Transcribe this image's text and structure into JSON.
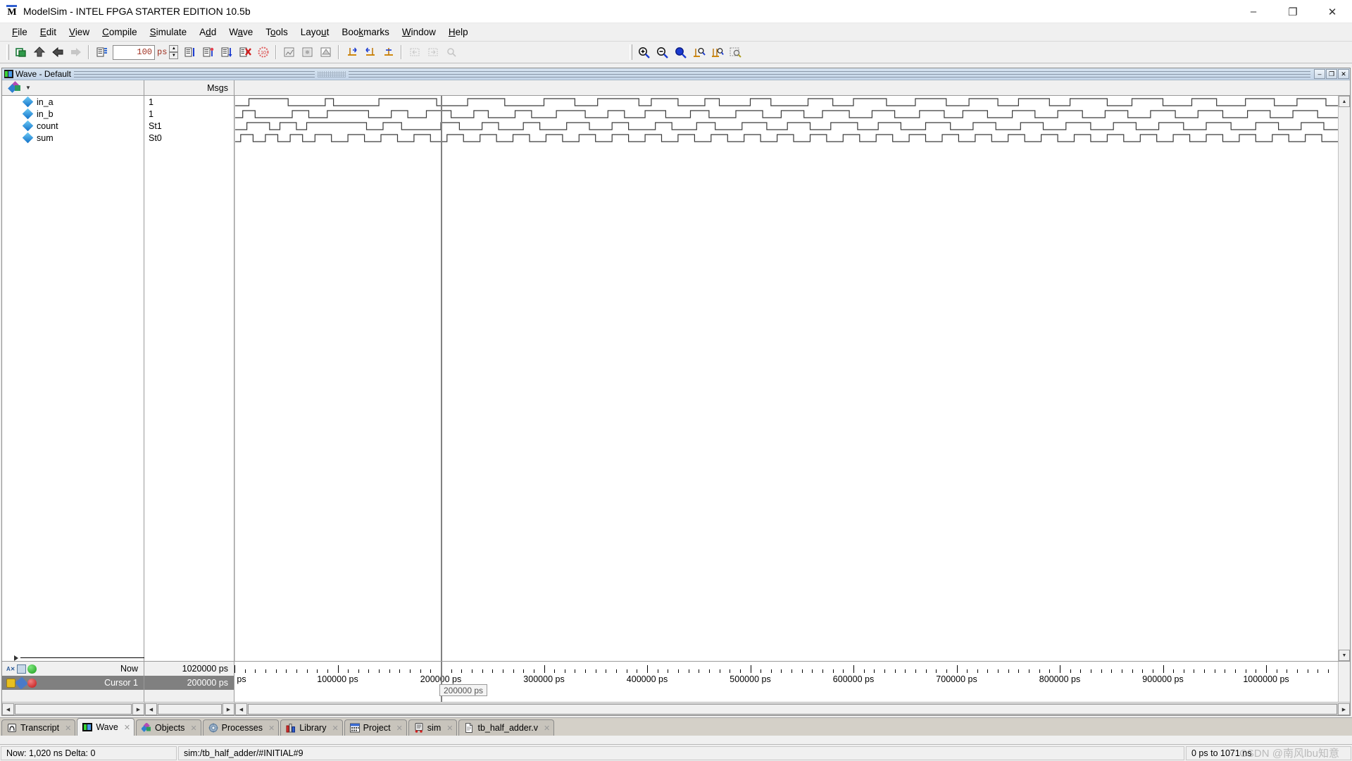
{
  "window": {
    "title": "ModelSim - INTEL FPGA STARTER EDITION 10.5b",
    "app_icon": "modelsim-icon",
    "minimize": "–",
    "maximize": "❐",
    "close": "✕"
  },
  "menubar": {
    "items": [
      {
        "label": "File",
        "mnemonic": "F"
      },
      {
        "label": "Edit",
        "mnemonic": "E"
      },
      {
        "label": "View",
        "mnemonic": "V"
      },
      {
        "label": "Compile",
        "mnemonic": "C"
      },
      {
        "label": "Simulate",
        "mnemonic": "S"
      },
      {
        "label": "Add",
        "mnemonic": "d"
      },
      {
        "label": "Wave",
        "mnemonic": "a"
      },
      {
        "label": "Tools",
        "mnemonic": "o"
      },
      {
        "label": "Layout",
        "mnemonic": "u"
      },
      {
        "label": "Bookmarks",
        "mnemonic": "k"
      },
      {
        "label": "Window",
        "mnemonic": "W"
      },
      {
        "label": "Help",
        "mnemonic": "H"
      }
    ]
  },
  "toolbar": {
    "run_time_value": "100",
    "run_time_unit": "ps",
    "buttons": [
      "copy-icon",
      "up-arrow-icon",
      "back-arrow-icon",
      "forward-faded-icon",
      "restart-icon",
      "run-icon",
      "continue-run-icon",
      "run-all-icon",
      "break-icon",
      "stop-icon",
      "step-icon",
      "step-over-icon",
      "step-out-icon",
      "insert-cursor-icon",
      "delete-cursor-icon",
      "find-previous-icon",
      "find-next-icon",
      "zoom-in-icon",
      "zoom-out-icon",
      "zoom-full-icon",
      "zoom-cursor-icon",
      "zoom-range-icon",
      "zoom-last-icon"
    ]
  },
  "wave_window": {
    "title": "Wave - Default",
    "icon": "wave-window-icon",
    "minimize": "–",
    "restore": "❐",
    "close": "✕",
    "msgs_header": "Msgs",
    "signals": [
      {
        "name": "in_a",
        "value": "1",
        "icon": "signal-diamond-icon"
      },
      {
        "name": "in_b",
        "value": "1",
        "icon": "signal-diamond-icon"
      },
      {
        "name": "count",
        "value": "St1",
        "icon": "signal-diamond-icon"
      },
      {
        "name": "sum",
        "value": "St0",
        "icon": "signal-diamond-icon"
      }
    ],
    "cursor_flag_label": "200000 ps",
    "now_label": "Now",
    "now_value": "1020000 ps",
    "cursor_label": "Cursor 1",
    "cursor_value": "200000 ps",
    "timeline": {
      "unit": "ps",
      "start_label": "ps",
      "labels": [
        "100000 ps",
        "200000 ps",
        "300000 ps",
        "400000 ps",
        "500000 ps",
        "600000 ps",
        "700000 ps",
        "800000 ps",
        "900000 ps",
        "1000000 ps"
      ],
      "min": 0,
      "max": 1071000,
      "major_step": 100000,
      "minor_step": 10000
    }
  },
  "waveforms": {
    "cursor_time": 200000,
    "traces": [
      {
        "signal": "in_a",
        "initial": 0,
        "edges": [
          14000,
          52000,
          88000,
          96000,
          140000,
          196000,
          226000,
          262000,
          300000,
          330000,
          352000,
          392000,
          404000,
          430000,
          456000,
          470000,
          500000,
          520000,
          556000,
          580000,
          600000,
          632000,
          660000,
          690000,
          712000,
          740000,
          760000,
          790000,
          810000,
          846000,
          870000,
          900000,
          928000,
          952000,
          980000,
          1008000,
          1030000,
          1058000
        ]
      },
      {
        "signal": "in_b",
        "initial": 0,
        "edges": [
          8000,
          20000,
          56000,
          72000,
          90000,
          130000,
          152000,
          168000,
          186000,
          210000,
          232000,
          246000,
          272000,
          288000,
          312000,
          340000,
          362000,
          378000,
          398000,
          418000,
          442000,
          460000,
          486000,
          512000,
          530000,
          552000,
          570000,
          596000,
          618000,
          640000,
          664000,
          688000,
          706000,
          730000,
          754000,
          776000,
          798000,
          822000,
          844000,
          866000,
          888000,
          912000,
          934000,
          958000,
          982000,
          1004000,
          1026000,
          1050000
        ]
      },
      {
        "signal": "count",
        "initial": 0,
        "edges": [
          12000,
          34000,
          44000,
          60000,
          70000,
          128000,
          144000,
          162000,
          200000,
          218000,
          240000,
          256000,
          280000,
          296000,
          322000,
          344000,
          366000,
          382000,
          408000,
          424000,
          448000,
          466000,
          492000,
          516000,
          536000,
          558000,
          578000,
          604000,
          624000,
          646000,
          670000,
          694000,
          716000,
          738000,
          762000,
          784000,
          806000,
          830000,
          852000,
          874000,
          896000,
          920000,
          942000,
          966000,
          990000,
          1012000,
          1034000,
          1056000
        ]
      },
      {
        "signal": "sum",
        "initial": 0,
        "edges": [
          6000,
          18000,
          30000,
          42000,
          54000,
          66000,
          78000,
          94000,
          110000,
          126000,
          142000,
          158000,
          174000,
          190000,
          206000,
          222000,
          238000,
          254000,
          270000,
          286000,
          302000,
          318000,
          334000,
          350000,
          366000,
          382000,
          398000,
          414000,
          430000,
          446000,
          462000,
          478000,
          494000,
          510000,
          526000,
          542000,
          558000,
          574000,
          590000,
          606000,
          622000,
          638000,
          654000,
          670000,
          686000,
          702000,
          718000,
          734000,
          750000,
          766000,
          782000,
          798000,
          814000,
          830000,
          846000,
          862000,
          878000,
          894000,
          910000,
          926000,
          942000,
          958000,
          974000,
          990000,
          1006000,
          1022000,
          1038000,
          1054000
        ]
      }
    ]
  },
  "tabs": [
    {
      "label": "Transcript",
      "icon": "transcript-icon",
      "active": false,
      "close": "✕"
    },
    {
      "label": "Wave",
      "icon": "wave-tab-icon",
      "active": true,
      "close": "✕"
    },
    {
      "label": "Objects",
      "icon": "objects-icon",
      "active": false,
      "close": "✕"
    },
    {
      "label": "Processes",
      "icon": "processes-icon",
      "active": false,
      "close": "✕"
    },
    {
      "label": "Library",
      "icon": "library-icon",
      "active": false,
      "close": "✕"
    },
    {
      "label": "Project",
      "icon": "project-icon",
      "active": false,
      "close": "✕"
    },
    {
      "label": "sim",
      "icon": "sim-icon",
      "active": false,
      "close": "✕"
    },
    {
      "label": "tb_half_adder.v",
      "icon": "file-icon",
      "active": false,
      "close": "✕"
    }
  ],
  "statusbar": {
    "now": "Now: 1,020 ns  Delta: 0",
    "path": "sim:/tb_half_adder/#INITIAL#9",
    "range": "0 ps to 1071 ns"
  },
  "watermark": "CSDN @南风lbu知意",
  "colors": {
    "accent_blue": "#2f7fd0",
    "title_bg": "#ffffff",
    "toolbar_bg": "#f0f0f0",
    "wave_bg": "#ffffff",
    "cursor_gray": "#808080",
    "selection_gray": "#808080"
  }
}
